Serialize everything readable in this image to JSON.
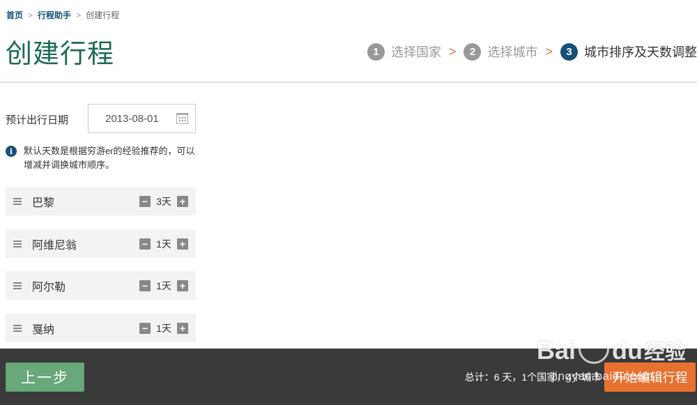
{
  "breadcrumb": {
    "home": "首页",
    "assistant": "行程助手",
    "current": "创建行程",
    "separator": ">"
  },
  "page_title": "创建行程",
  "steps": [
    {
      "num": "1",
      "label": "选择国家",
      "active": false
    },
    {
      "num": "2",
      "label": "选择城市",
      "active": false
    },
    {
      "num": "3",
      "label": "城市排序及天数调整",
      "active": true
    }
  ],
  "step_arrow": ">",
  "date": {
    "label": "预计出行日期",
    "value": "2013-08-01",
    "icon": "calendar-icon"
  },
  "info": {
    "icon": "i",
    "text": "默认天数是根据穷游er的经验推荐的，可以增减并调换城市顺序。"
  },
  "cities": [
    {
      "name": "巴黎",
      "days": "3天"
    },
    {
      "name": "阿维尼翁",
      "days": "1天"
    },
    {
      "name": "阿尔勒",
      "days": "1天"
    },
    {
      "name": "戛纳",
      "days": "1天"
    }
  ],
  "stepper": {
    "minus": "−",
    "plus": "+"
  },
  "footer": {
    "prev_label": "上一步",
    "summary": "总计：6 天，1个国家，4个城市",
    "start_label": "开始编辑行程"
  },
  "watermark": {
    "brand": "Bai",
    "brand2": "du",
    "cn": "经验",
    "url": "jingyan.baidu.com"
  },
  "colors": {
    "title": "#1d6b52",
    "link": "#17507a",
    "accent": "#e8712f",
    "prev": "#68a87a",
    "footer": "#3a3a3a"
  }
}
